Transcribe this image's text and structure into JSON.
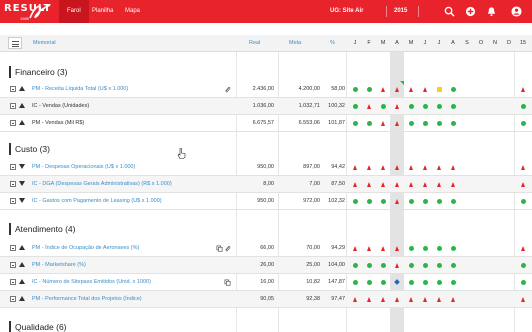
{
  "app": {
    "logo_text": "RESULT",
    "logo_year": "1985",
    "nav": [
      "Farol",
      "Planilha",
      "Mapa"
    ],
    "active_nav": "Farol",
    "unit": "UG: Site Air",
    "year": "2015",
    "accent_color": "#e8232b",
    "icons": [
      "search-icon",
      "plus-circle-icon",
      "bell-icon",
      "user-icon"
    ]
  },
  "header": {
    "menu_icon": "hamburger-icon",
    "col_name": "Memorial",
    "col_real": "Real",
    "col_meta": "Meta",
    "col_pct": "%",
    "months": [
      "J",
      "F",
      "M",
      "A",
      "M",
      "J",
      "J",
      "A",
      "S",
      "O",
      "N",
      "D",
      "15"
    ]
  },
  "legend_colors": {
    "green": "#2db34a",
    "red": "#e8232b",
    "yellow": "#f2d21a",
    "blue": "#2a61c8"
  },
  "sections": [
    {
      "title": "Financeiro (3)",
      "rows": [
        {
          "name": "PM - Receita Líquida Total (U$ x 1.000)",
          "link": true,
          "arrow": "up",
          "icons": [
            "paperclip-icon"
          ],
          "real": "2.436,00",
          "meta": "4.200,00",
          "pct": "58,00",
          "status": [
            "dot",
            "dot",
            "tri",
            "tri",
            "tri",
            "tri",
            "sq",
            "dot",
            "",
            "",
            "",
            "",
            "tri"
          ],
          "flag": true
        },
        {
          "name": "IC - Vendas (Unidades)",
          "link": false,
          "arrow": "up",
          "icons": [],
          "real": "1.036,00",
          "meta": "1.032,71",
          "pct": "100,32",
          "status": [
            "dot",
            "tri",
            "dot",
            "tri",
            "dot",
            "dot",
            "dot",
            "dot",
            "",
            "",
            "",
            "",
            "dot"
          ],
          "flag": false
        },
        {
          "name": "PM - Vendas (Mil R$)",
          "link": false,
          "arrow": "up",
          "icons": [],
          "real": "6.675,57",
          "meta": "6.553,06",
          "pct": "101,87",
          "status": [
            "dot",
            "dot",
            "tri",
            "tri",
            "dot",
            "dot",
            "dot",
            "dot",
            "",
            "",
            "",
            "",
            "dot"
          ],
          "flag": false
        }
      ]
    },
    {
      "title": "Custo (3)",
      "rows": [
        {
          "name": "PM - Despesas Operacionais (U$ x 1.000)",
          "link": true,
          "arrow": "down",
          "icons": [],
          "real": "950,00",
          "meta": "897,00",
          "pct": "94,42",
          "status": [
            "tri",
            "tri",
            "tri",
            "tri",
            "tri",
            "tri",
            "tri",
            "tri",
            "",
            "",
            "",
            "",
            "tri"
          ],
          "flag": false
        },
        {
          "name": "IC - DGA (Despesas Gerais Administrativas) (R$ x 1.000)",
          "link": true,
          "arrow": "down",
          "icons": [],
          "real": "8,00",
          "meta": "7,00",
          "pct": "87,50",
          "status": [
            "tri",
            "tri",
            "tri",
            "tri",
            "tri",
            "tri",
            "tri",
            "tri",
            "",
            "",
            "",
            "",
            "tri"
          ],
          "flag": false
        },
        {
          "name": "IC - Gastos com Pagamento de Leasing (U$ x 1.000)",
          "link": true,
          "arrow": "down",
          "icons": [],
          "real": "950,00",
          "meta": "972,00",
          "pct": "102,32",
          "status": [
            "dot",
            "dot",
            "dot",
            "tri",
            "dot",
            "dot",
            "dot",
            "dot",
            "",
            "",
            "",
            "",
            "dot"
          ],
          "flag": false
        }
      ]
    },
    {
      "title": "Atendimento (4)",
      "rows": [
        {
          "name": "PM - Índice de Ocupação de Aeronaves (%)",
          "link": true,
          "arrow": "up",
          "icons": [
            "copy-icon",
            "paperclip-icon"
          ],
          "real": "66,00",
          "meta": "70,00",
          "pct": "94,29",
          "status": [
            "tri",
            "tri",
            "tri",
            "tri",
            "dot",
            "dot",
            "dot",
            "dot",
            "",
            "",
            "",
            "",
            "tri"
          ],
          "flag": false
        },
        {
          "name": "PM - Marketshare (%)",
          "link": true,
          "arrow": "up",
          "icons": [],
          "real": "26,00",
          "meta": "25,00",
          "pct": "104,00",
          "status": [
            "dot",
            "dot",
            "dot",
            "tri",
            "dot",
            "dot",
            "dot",
            "dot",
            "",
            "",
            "",
            "",
            "dot"
          ],
          "flag": false
        },
        {
          "name": "IC - Número de Sitepass Emitidos (Unid. x 1000)",
          "link": true,
          "arrow": "up",
          "icons": [
            "copy-icon"
          ],
          "real": "16,00",
          "meta": "10,82",
          "pct": "147,87",
          "status": [
            "dot",
            "dot",
            "dot",
            "dia",
            "dot",
            "dot",
            "dot",
            "dot",
            "",
            "",
            "",
            "",
            "dot"
          ],
          "flag": false
        },
        {
          "name": "PM - Performance Total dos Projetos (Índice)",
          "link": true,
          "arrow": "up",
          "icons": [],
          "real": "90,05",
          "meta": "92,38",
          "pct": "97,47",
          "status": [
            "tri",
            "tri",
            "tri",
            "tri",
            "tri",
            "tri",
            "tri",
            "tri",
            "",
            "",
            "",
            "",
            "tri"
          ],
          "flag": false
        }
      ]
    },
    {
      "title": "Qualidade (6)",
      "rows": []
    }
  ]
}
